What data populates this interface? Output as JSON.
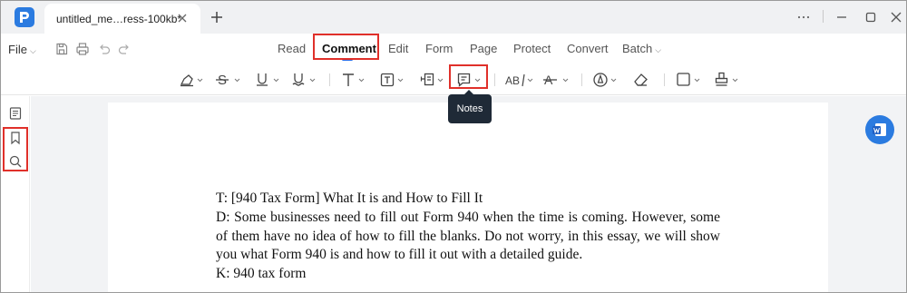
{
  "titlebar": {
    "tab_title": "untitled_me…ress-100kb*"
  },
  "menu": {
    "file_label": "File",
    "items": [
      {
        "label": "Read",
        "active": false
      },
      {
        "label": "Comment",
        "active": true
      },
      {
        "label": "Edit",
        "active": false
      },
      {
        "label": "Form",
        "active": false
      },
      {
        "label": "Page",
        "active": false
      },
      {
        "label": "Protect",
        "active": false
      },
      {
        "label": "Convert",
        "active": false
      },
      {
        "label": "Batch",
        "active": false
      }
    ]
  },
  "toolbar": {
    "tools": [
      "highlight-icon",
      "strikethrough-icon",
      "underline-icon",
      "squiggly-underline-icon",
      "text-icon",
      "textbox-icon",
      "callout-icon",
      "note-icon",
      "replace-text-icon",
      "insert-text-icon",
      "pencil-icon",
      "eraser-icon",
      "shape-icon",
      "stamp-icon"
    ]
  },
  "tooltip": {
    "text": "Notes"
  },
  "sidebar": {
    "icons": [
      "thumbnails-icon",
      "bookmark-icon",
      "search-icon"
    ]
  },
  "document": {
    "lines": [
      "T: [940 Tax Form] What It is and How to Fill It",
      "D: Some businesses need to fill out Form 940 when the time is coming. However, some of them have no idea of how to fill the blanks. Do not worry, in this essay, we will show you what Form 940 is and how to fill it out with a detailed guide.",
      "K: 940 tax form"
    ]
  },
  "colors": {
    "accent": "#2d6fe8",
    "highlight_box": "#e0302a",
    "tooltip_bg": "#1f2a37",
    "workspace_bg": "#f2f3f5"
  }
}
